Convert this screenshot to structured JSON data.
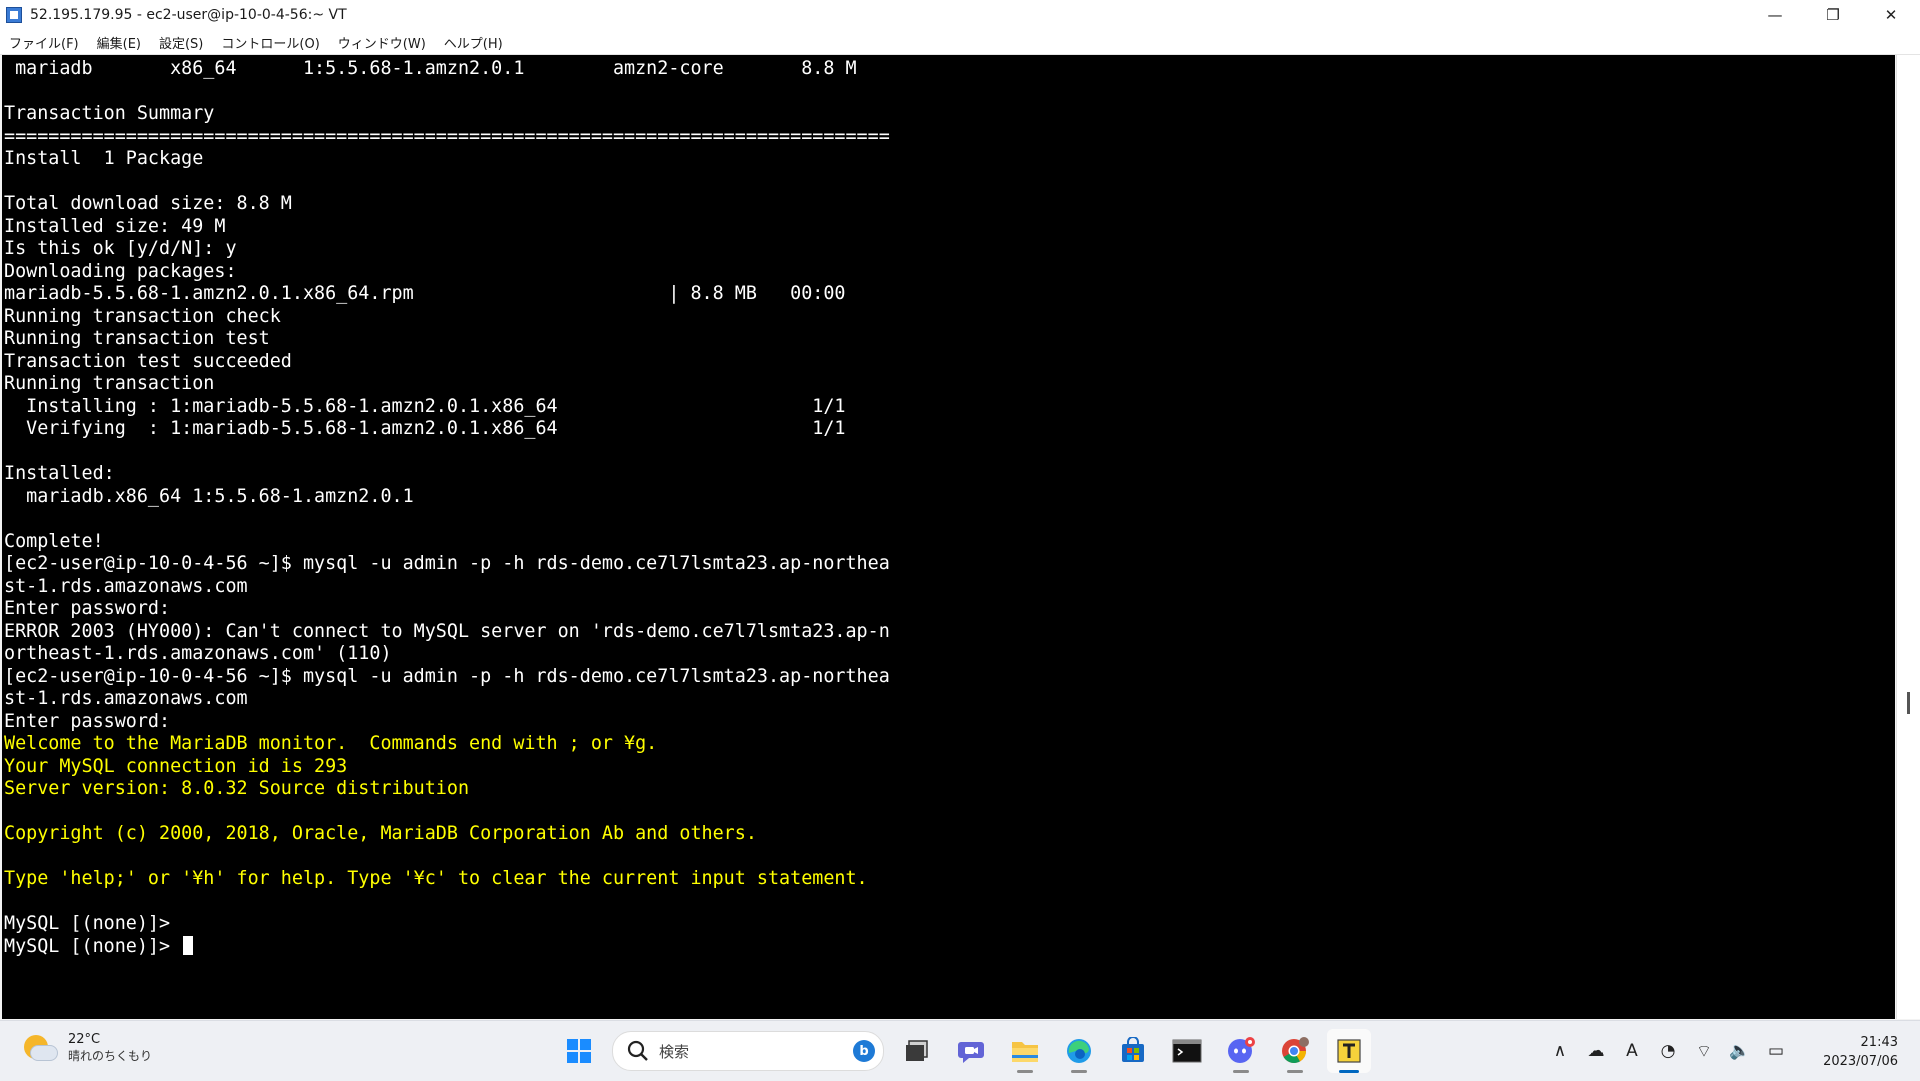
{
  "window": {
    "title": "52.195.179.95 - ec2-user@ip-10-0-4-56:~ VT",
    "minimize_glyph": "—",
    "restore_glyph": "❐",
    "close_glyph": "✕"
  },
  "menu": {
    "items": [
      "ファイル(F)",
      "編集(E)",
      "設定(S)",
      "コントロール(O)",
      "ウィンドウ(W)",
      "ヘルプ(H)"
    ]
  },
  "terminal": {
    "lines": [
      {
        "text": " mariadb       x86_64      1:5.5.68-1.amzn2.0.1        amzn2-core       8.8 M",
        "color": "white"
      },
      {
        "text": "",
        "color": "white"
      },
      {
        "text": "Transaction Summary",
        "color": "white"
      },
      {
        "text": "================================================================================",
        "color": "white"
      },
      {
        "text": "Install  1 Package",
        "color": "white"
      },
      {
        "text": "",
        "color": "white"
      },
      {
        "text": "Total download size: 8.8 M",
        "color": "white"
      },
      {
        "text": "Installed size: 49 M",
        "color": "white"
      },
      {
        "text": "Is this ok [y/d/N]: y",
        "color": "white"
      },
      {
        "text": "Downloading packages:",
        "color": "white"
      },
      {
        "text": "mariadb-5.5.68-1.amzn2.0.1.x86_64.rpm                       | 8.8 MB   00:00",
        "color": "white"
      },
      {
        "text": "Running transaction check",
        "color": "white"
      },
      {
        "text": "Running transaction test",
        "color": "white"
      },
      {
        "text": "Transaction test succeeded",
        "color": "white"
      },
      {
        "text": "Running transaction",
        "color": "white"
      },
      {
        "text": "  Installing : 1:mariadb-5.5.68-1.amzn2.0.1.x86_64                       1/1",
        "color": "white"
      },
      {
        "text": "  Verifying  : 1:mariadb-5.5.68-1.amzn2.0.1.x86_64                       1/1",
        "color": "white"
      },
      {
        "text": "",
        "color": "white"
      },
      {
        "text": "Installed:",
        "color": "white"
      },
      {
        "text": "  mariadb.x86_64 1:5.5.68-1.amzn2.0.1",
        "color": "white"
      },
      {
        "text": "",
        "color": "white"
      },
      {
        "text": "Complete!",
        "color": "white"
      },
      {
        "text": "[ec2-user@ip-10-0-4-56 ~]$ mysql -u admin -p -h rds-demo.ce7l7lsmta23.ap-northea",
        "color": "white"
      },
      {
        "text": "st-1.rds.amazonaws.com",
        "color": "white"
      },
      {
        "text": "Enter password:",
        "color": "white"
      },
      {
        "text": "ERROR 2003 (HY000): Can't connect to MySQL server on 'rds-demo.ce7l7lsmta23.ap-n",
        "color": "white"
      },
      {
        "text": "ortheast-1.rds.amazonaws.com' (110)",
        "color": "white"
      },
      {
        "text": "[ec2-user@ip-10-0-4-56 ~]$ mysql -u admin -p -h rds-demo.ce7l7lsmta23.ap-northea",
        "color": "white"
      },
      {
        "text": "st-1.rds.amazonaws.com",
        "color": "white"
      },
      {
        "text": "Enter password:",
        "color": "white"
      },
      {
        "text": "Welcome to the MariaDB monitor.  Commands end with ; or ¥g.",
        "color": "yellow"
      },
      {
        "text": "Your MySQL connection id is 293",
        "color": "yellow"
      },
      {
        "text": "Server version: 8.0.32 Source distribution",
        "color": "yellow"
      },
      {
        "text": "",
        "color": "yellow"
      },
      {
        "text": "Copyright (c) 2000, 2018, Oracle, MariaDB Corporation Ab and others.",
        "color": "yellow"
      },
      {
        "text": "",
        "color": "yellow"
      },
      {
        "text": "Type 'help;' or '¥h' for help. Type '¥c' to clear the current input statement.",
        "color": "yellow"
      },
      {
        "text": "",
        "color": "white"
      },
      {
        "text": "MySQL [(none)]>",
        "color": "white"
      },
      {
        "text": "MySQL [(none)]> ",
        "color": "white",
        "cursor": true
      }
    ],
    "colors": {
      "background": "#000000",
      "white": "#ffffff",
      "yellow": "#ffff00"
    }
  },
  "taskbar": {
    "weather": {
      "temp": "22°C",
      "desc": "晴れのちくもり",
      "icon": "partly-cloudy-icon"
    },
    "search_placeholder": "検索",
    "bing_label": "b",
    "pinned": [
      {
        "name": "start-icon",
        "running": false
      },
      {
        "name": "task-view-icon",
        "running": false
      },
      {
        "name": "teams-chat-icon",
        "running": false
      },
      {
        "name": "file-explorer-icon",
        "running": true
      },
      {
        "name": "edge-icon",
        "running": true
      },
      {
        "name": "ms-store-icon",
        "running": false
      },
      {
        "name": "terminal-icon",
        "running": false
      },
      {
        "name": "discord-icon",
        "running": true
      },
      {
        "name": "chrome-icon",
        "running": true
      },
      {
        "name": "teraterm-icon",
        "running": true,
        "active": true
      }
    ],
    "tray": [
      {
        "name": "show-hidden-icon",
        "glyph": "∧"
      },
      {
        "name": "onedrive-icon",
        "glyph": "☁"
      },
      {
        "name": "ime-icon",
        "glyph": "A"
      },
      {
        "name": "sync-icon",
        "glyph": "◔"
      },
      {
        "name": "wifi-icon",
        "glyph": "⌔"
      },
      {
        "name": "volume-icon",
        "glyph": "🔈"
      },
      {
        "name": "battery-icon",
        "glyph": "▭"
      }
    ],
    "clock": {
      "time": "21:43",
      "date": "2023/07/06"
    },
    "accent": "#0067c0"
  }
}
